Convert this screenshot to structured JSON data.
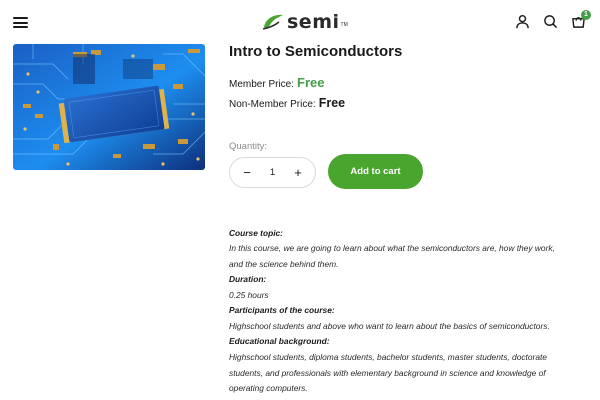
{
  "header": {
    "logo_text": "semi",
    "logo_tm": "TM",
    "cart_count": "1",
    "brand_green": "#43a047"
  },
  "product": {
    "title": "Intro to Semiconductors",
    "member_price_label": "Member Price",
    "member_price": "Free",
    "non_member_price_label": "Non-Member Price",
    "non_member_price": "Free",
    "quantity_label": "Quantity:",
    "quantity_value": "1",
    "minus_label": "−",
    "plus_label": "+",
    "add_to_cart_label": "Add to cart"
  },
  "description": {
    "course_topic_heading": "Course topic:",
    "course_topic_line1": "In this course, we are going to learn about what the semiconductors are, how they work,",
    "course_topic_line2": "and the science behind them.",
    "duration_heading": "Duration:",
    "duration_value": "0.25 hours",
    "participants_heading": "Participants of the course:",
    "participants_value": "Highschool students and above who want to learn about the basics of semiconductors.",
    "education_heading": "Educational background:",
    "education_line1": "Highschool students, diploma students, bachelor students, master students, doctorate",
    "education_line2": "students, and professionals with elementary background in science and knowledge of",
    "education_line3": "operating computers."
  }
}
